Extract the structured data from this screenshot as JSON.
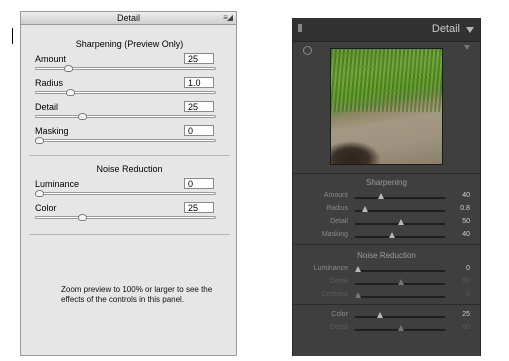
{
  "left_panel": {
    "title": "Detail",
    "menu_glyph": "≡◢",
    "sharpening_title": "Sharpening  (Preview Only)",
    "sharpening_controls": [
      {
        "label": "Amount",
        "value": "25",
        "fraction": 0.17
      },
      {
        "label": "Radius",
        "value": "1.0",
        "fraction": 0.18
      },
      {
        "label": "Detail",
        "value": "25",
        "fraction": 0.25
      },
      {
        "label": "Masking",
        "value": "0",
        "fraction": 0.0
      }
    ],
    "noise_title": "Noise Reduction",
    "noise_controls": [
      {
        "label": "Luminance",
        "value": "0",
        "fraction": 0.0
      },
      {
        "label": "Color",
        "value": "25",
        "fraction": 0.25
      }
    ],
    "info_text": "Zoom preview to 100% or larger to see the effects of the controls in this panel."
  },
  "right_panel": {
    "title": "Detail",
    "sharpening_title": "Sharpening",
    "sharpening_controls": [
      {
        "label": "Amount",
        "value": "40",
        "fraction": 0.27,
        "dim": false
      },
      {
        "label": "Radius",
        "value": "0.8",
        "fraction": 0.08,
        "dim": false
      },
      {
        "label": "Detail",
        "value": "50",
        "fraction": 0.5,
        "dim": false
      },
      {
        "label": "Masking",
        "value": "40",
        "fraction": 0.4,
        "dim": false
      }
    ],
    "noise_title": "Noise Reduction",
    "noise_controls": [
      {
        "label": "Luminance",
        "value": "0",
        "fraction": 0.0,
        "dim": false
      },
      {
        "label": "Detail",
        "value": "50",
        "fraction": 0.5,
        "dim": true
      },
      {
        "label": "Contrast",
        "value": "0",
        "fraction": 0.0,
        "dim": true
      }
    ],
    "color_controls": [
      {
        "label": "Color",
        "value": "25",
        "fraction": 0.25,
        "dim": false
      },
      {
        "label": "Detail",
        "value": "50",
        "fraction": 0.5,
        "dim": true
      }
    ]
  }
}
